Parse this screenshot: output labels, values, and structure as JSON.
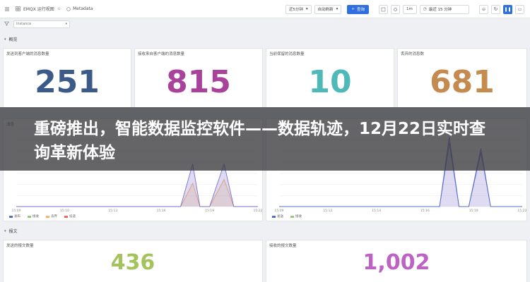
{
  "topbar": {
    "tab1": "EMQX 运行视图",
    "tab2": "Metadata",
    "time_select": "近5分钟",
    "refresh_select": "自动刷新",
    "query_button": "查询",
    "zoom_text": "1m",
    "range_text": "最近 15 分钟"
  },
  "filter": {
    "label": "筛选",
    "input_value": "instance"
  },
  "section1": {
    "label": "概览"
  },
  "section2": {
    "label": "报文"
  },
  "stats": [
    {
      "title": "发送到客户端的消息数量",
      "value": "251",
      "color": "#3b5a8a"
    },
    {
      "title": "接收来自客户端的消息数量",
      "value": "815",
      "color": "#a8429a"
    },
    {
      "title": "当前保留的消息数量",
      "value": "10",
      "color": "#4fb8b8"
    },
    {
      "title": "丢弃的消息数",
      "value": "681",
      "color": "#c48a4e"
    }
  ],
  "stats2": [
    {
      "title": "发送的报文数量",
      "value": "436",
      "color": "#a5c35c"
    },
    {
      "title": "接收的报文数量",
      "value": "1,002",
      "color": "#bd63c4"
    }
  ],
  "chart_left": {
    "title": "消息",
    "x_ticks": [
      "15:09",
      "15:10",
      "15:13",
      "15:16",
      "15:19",
      "15:22"
    ],
    "legend": [
      "发布",
      "接收",
      "丢弃",
      "投递"
    ]
  },
  "chart_right": {
    "x_ticks": [
      "15:09",
      "15:12",
      "15:14",
      "15:16",
      "15:19",
      "15:22"
    ],
    "legend": [
      "发送",
      "接收"
    ]
  },
  "colors": {
    "blue": "#5470c6",
    "green": "#91cc75",
    "orange": "#f6b26b",
    "red": "#ee6666",
    "purple": "#7b6fd0"
  },
  "banner": {
    "title": "重磅推出，智能数据监控软件——数据轨迹，12月22日实时查询革新体验"
  }
}
